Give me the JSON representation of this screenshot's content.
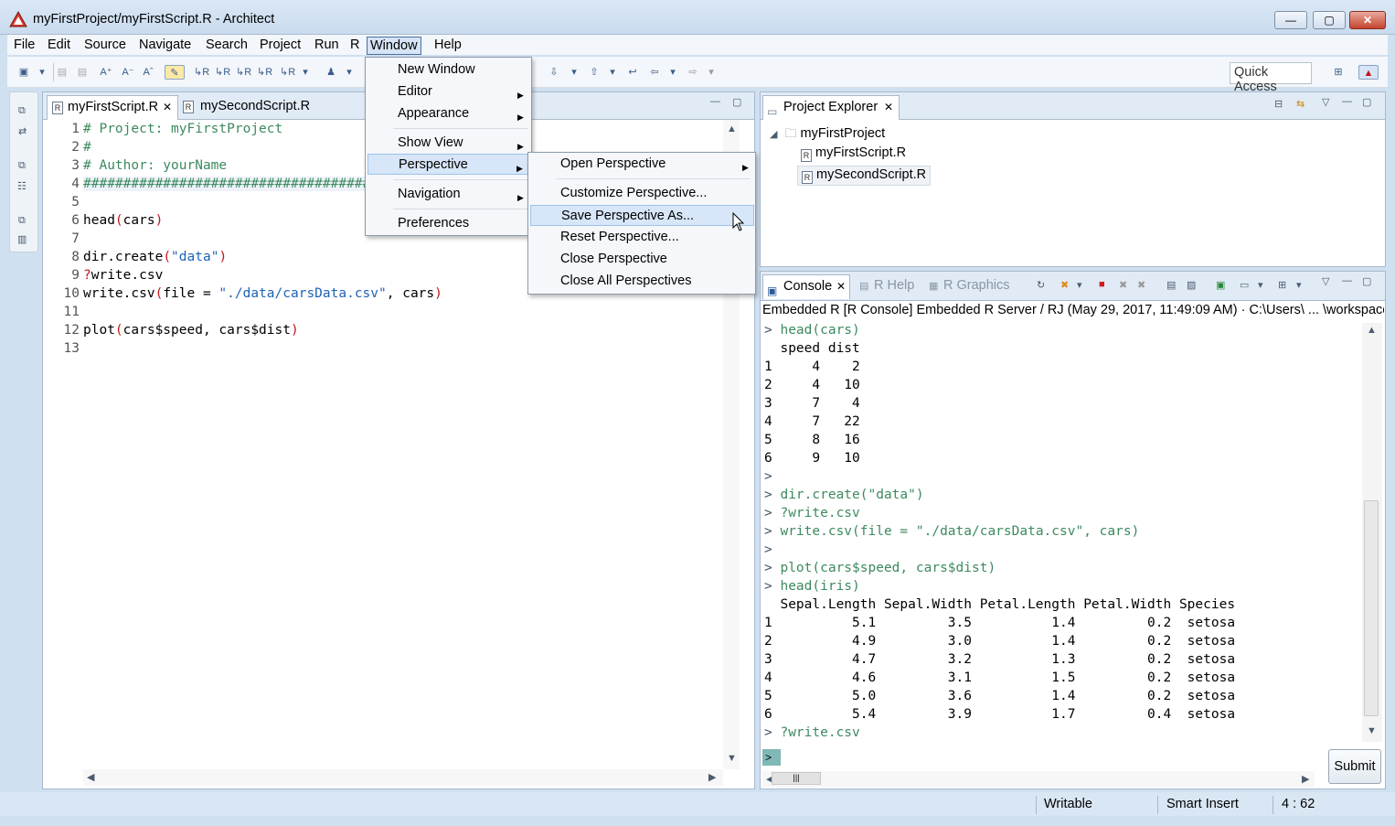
{
  "window": {
    "title": "myFirstProject/myFirstScript.R - Architect",
    "controls": {
      "minimize": "—",
      "maximize": "▢",
      "close": "✕"
    }
  },
  "menubar": [
    "File",
    "Edit",
    "Source",
    "Navigate",
    "Search",
    "Project",
    "Run",
    "R",
    "Window",
    "Help"
  ],
  "toolbar": {
    "quick_access": "Quick Access"
  },
  "editor": {
    "tabs": [
      {
        "label": "myFirstScript.R",
        "active": true
      },
      {
        "label": "mySecondScript.R",
        "active": false
      }
    ],
    "lines": [
      {
        "n": "1",
        "text": "# Project: myFirstProject"
      },
      {
        "n": "2",
        "text": "#"
      },
      {
        "n": "3",
        "text": "# Author: yourName"
      },
      {
        "n": "4",
        "text": "######################################"
      },
      {
        "n": "5",
        "text": ""
      },
      {
        "n": "6",
        "text": "head(cars)"
      },
      {
        "n": "7",
        "text": ""
      },
      {
        "n": "8",
        "text": "dir.create(\"data\")"
      },
      {
        "n": "9",
        "text": "?write.csv"
      },
      {
        "n": "10",
        "text": "write.csv(file = \"./data/carsData.csv\", cars)"
      },
      {
        "n": "11",
        "text": ""
      },
      {
        "n": "12",
        "text": "plot(cars$speed, cars$dist)"
      },
      {
        "n": "13",
        "text": ""
      }
    ]
  },
  "explorer": {
    "tab": "Project Explorer",
    "project": "myFirstProject",
    "files": [
      "myFirstScript.R",
      "mySecondScript.R"
    ],
    "selected": "mySecondScript.R"
  },
  "console": {
    "tabs": [
      "Console",
      "R Help",
      "R Graphics"
    ],
    "description": "Embedded R [R Console] Embedded R Server / RJ (May 29, 2017, 11:49:09 AM)  ·  C:\\Users\\ ... \\workspace",
    "lines": [
      {
        "p": ">",
        "t": "head(cars)",
        "kind": "in"
      },
      {
        "p": "",
        "t": "  speed dist",
        "kind": "out"
      },
      {
        "p": "",
        "t": "1     4    2",
        "kind": "out"
      },
      {
        "p": "",
        "t": "2     4   10",
        "kind": "out"
      },
      {
        "p": "",
        "t": "3     7    4",
        "kind": "out"
      },
      {
        "p": "",
        "t": "4     7   22",
        "kind": "out"
      },
      {
        "p": "",
        "t": "5     8   16",
        "kind": "out"
      },
      {
        "p": "",
        "t": "6     9   10",
        "kind": "out"
      },
      {
        "p": ">",
        "t": "",
        "kind": "in"
      },
      {
        "p": ">",
        "t": "dir.create(\"data\")",
        "kind": "in"
      },
      {
        "p": ">",
        "t": "?write.csv",
        "kind": "in"
      },
      {
        "p": ">",
        "t": "write.csv(file = \"./data/carsData.csv\", cars)",
        "kind": "in"
      },
      {
        "p": ">",
        "t": "",
        "kind": "in"
      },
      {
        "p": ">",
        "t": "plot(cars$speed, cars$dist)",
        "kind": "in"
      },
      {
        "p": ">",
        "t": "head(iris)",
        "kind": "in"
      },
      {
        "p": "",
        "t": "  Sepal.Length Sepal.Width Petal.Length Petal.Width Species",
        "kind": "out"
      },
      {
        "p": "",
        "t": "1          5.1         3.5          1.4         0.2  setosa",
        "kind": "out"
      },
      {
        "p": "",
        "t": "2          4.9         3.0          1.4         0.2  setosa",
        "kind": "out"
      },
      {
        "p": "",
        "t": "3          4.7         3.2          1.3         0.2  setosa",
        "kind": "out"
      },
      {
        "p": "",
        "t": "4          4.6         3.1          1.5         0.2  setosa",
        "kind": "out"
      },
      {
        "p": "",
        "t": "5          5.0         3.6          1.4         0.2  setosa",
        "kind": "out"
      },
      {
        "p": "",
        "t": "6          5.4         3.9          1.7         0.4  setosa",
        "kind": "out"
      },
      {
        "p": ">",
        "t": "?write.csv",
        "kind": "in"
      }
    ],
    "submit": "Submit"
  },
  "window_menu": {
    "items": [
      {
        "label": "New Window",
        "submenu": false
      },
      {
        "label": "Editor",
        "submenu": true
      },
      {
        "label": "Appearance",
        "submenu": true
      },
      {
        "label": "Show View",
        "submenu": true
      },
      {
        "label": "Perspective",
        "submenu": true
      },
      {
        "label": "Navigation",
        "submenu": true
      },
      {
        "label": "Preferences",
        "submenu": false
      }
    ],
    "highlighted": "Perspective"
  },
  "perspective_menu": {
    "items": [
      {
        "label": "Open Perspective",
        "submenu": true
      },
      {
        "label": "Customize Perspective...",
        "submenu": false
      },
      {
        "label": "Save Perspective As...",
        "submenu": false
      },
      {
        "label": "Reset Perspective...",
        "submenu": false
      },
      {
        "label": "Close Perspective",
        "submenu": false
      },
      {
        "label": "Close All Perspectives",
        "submenu": false
      }
    ],
    "highlighted": "Save Perspective As..."
  },
  "statusbar": {
    "mode": "Writable",
    "insert": "Smart Insert",
    "position": "4 : 62"
  },
  "colors": {
    "comment": "#3c8a5e",
    "string": "#1e63b5",
    "paren": "#c0161c",
    "console_input": "#3c8a5e",
    "menu_highlight": "#d7e6f8"
  }
}
